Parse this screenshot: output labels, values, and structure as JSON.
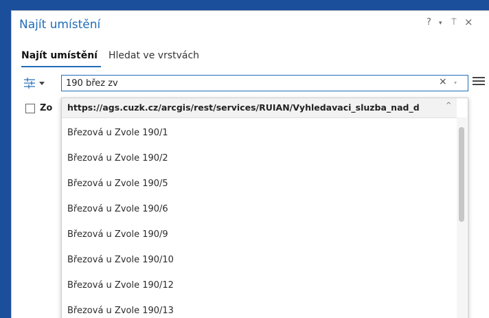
{
  "pane": {
    "title": "Najít umístění",
    "help": "?",
    "menu_arrow": "▾",
    "pin": "⍑",
    "close": "×"
  },
  "tabs": [
    {
      "label": "Najít umístění",
      "active": true
    },
    {
      "label": "Hledat ve vrstvách",
      "active": false
    }
  ],
  "search": {
    "value": "190 břez zv",
    "clear": "×",
    "dropdown_arrow": "▾"
  },
  "options": {
    "zoom_checkbox_label": "Zo",
    "checked": false
  },
  "dropdown": {
    "source": "https://ags.cuzk.cz/arcgis/rest/services/RUIAN/Vyhledavaci_sluzba_nad_d",
    "collapse": "^",
    "suggestions": [
      "Březová u Zvole 190/1",
      "Březová u Zvole 190/2",
      "Březová u Zvole 190/5",
      "Březová u Zvole 190/6",
      "Březová u Zvole 190/9",
      "Březová u Zvole 190/10",
      "Březová u Zvole 190/12",
      "Březová u Zvole 190/13"
    ]
  },
  "colors": {
    "accent": "#1f6cb7",
    "background": "#1b4f9c"
  },
  "icons": {
    "filter": "sliders-icon",
    "menu": "hamburger-menu-icon"
  }
}
